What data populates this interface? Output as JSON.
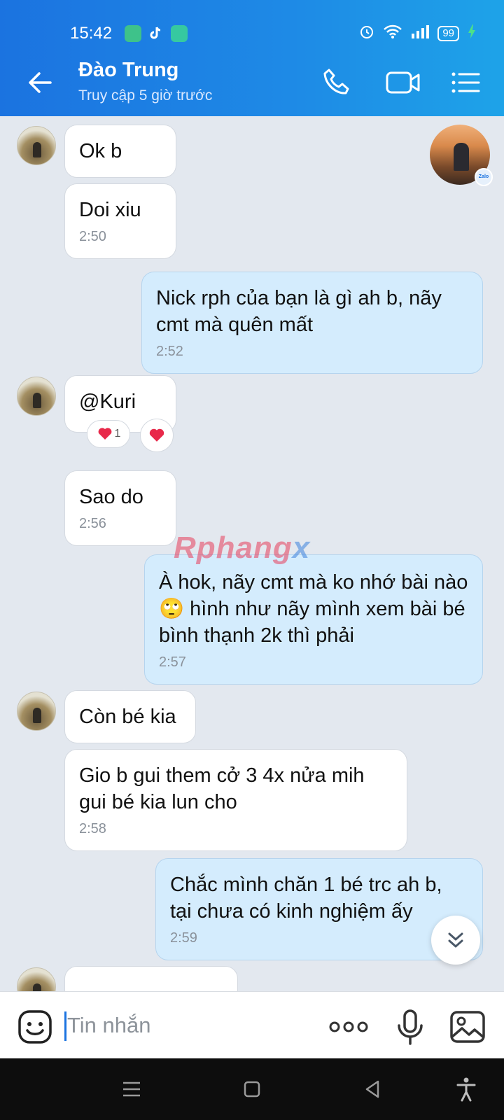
{
  "status_bar": {
    "time": "15:42",
    "battery": "99"
  },
  "header": {
    "name": "Đào Trung",
    "status": "Truy cập 5 giờ trước"
  },
  "messages": {
    "m1": {
      "text": "Ok b"
    },
    "m2": {
      "text": "Doi xiu",
      "time": "2:50"
    },
    "m3": {
      "text": "Nick rph của bạn là gì ah b, nãy cmt mà quên mất",
      "time": "2:52"
    },
    "m4": {
      "text": "@Kuri",
      "reaction_count": "1"
    },
    "m5": {
      "text": "Sao do",
      "time": "2:56"
    },
    "m6": {
      "text": "À hok, nãy cmt mà ko nhớ bài nào 🙄 hình như nãy mình xem bài bé bình thạnh 2k thì phải",
      "time": "2:57"
    },
    "m7": {
      "text": "Còn bé kia"
    },
    "m8": {
      "text": "Gio b gui them cở 3 4x nửa mih gui bé kia lun cho",
      "time": "2:58"
    },
    "m9": {
      "text": "Chắc mình chăn 1 bé trc ah b, tại chưa có kinh nghiệm ấy",
      "time": "2:59"
    }
  },
  "badge": {
    "zalo": "Zalo"
  },
  "watermark": {
    "main": "Rphang",
    "suffix": "x"
  },
  "composer": {
    "placeholder": "Tin nhắn"
  },
  "icons": {
    "back": "arrow-left-icon",
    "call": "phone-icon",
    "video": "video-camera-icon",
    "menu": "list-menu-icon",
    "sticker": "emoji-icon",
    "more": "more-dots-icon",
    "mic": "microphone-icon",
    "image": "image-icon",
    "scroll": "double-chevron-down-icon",
    "heart": "heart-icon"
  },
  "colors": {
    "header_start": "#1b73e0",
    "header_end": "#1ea3e8",
    "incoming": "#ffffff",
    "outgoing": "#d4ecfd",
    "accent": "#1b73e0"
  }
}
